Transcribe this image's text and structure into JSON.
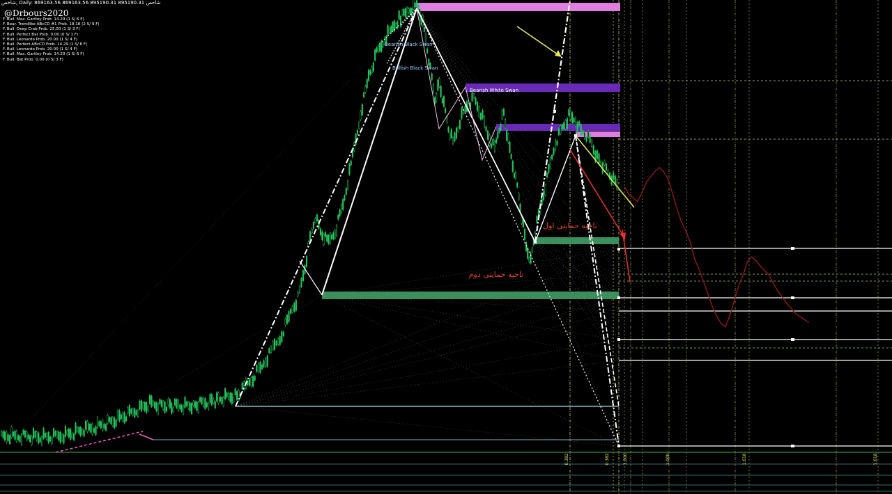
{
  "header": {
    "instrument": "شاخص",
    "timeframe": "Daily",
    "ohlc": "869163.56 869163.56 895190.31 895190.31",
    "instrument_repeat": "شاخص"
  },
  "watermark": "@Drbours2020",
  "pattern_probabilities": [
    "F. Bull. Max. Gartley Prob. 14.29 (1 S/ 6 F)",
    "F. Bear. Trendlike ABcCD #1 Prob. 18.18 (2 S/ 9 F)",
    "F. Bull. Deep Crab Prob. 25.00 (1 S/ 3 F)",
    "F. Bull. Perfect Bat Prob. 0.00 (0 S/ 1 F)",
    "F. Bull. Leonardo Prob. 20.00 (1 S/ 4 F)",
    "F. Bull. Perfect ABcCD Prob. 14.29 (1 S/ 6 F)",
    "F. Bull. Leonardo Prob. 20.00 (1 S/ 4 F)",
    "F. Bull. Max. Gartley Prob. 14.29 (1 S/ 6 F)",
    "F. Bull. Bat Prob. 0.00 (0 S/ 3 F)"
  ],
  "pattern_labels": {
    "bearish_black_swan": "Bearish Black Swan",
    "bullish_black_swan": "Bullish Black Swan",
    "bearish_white_swan": "Bearish White Swan"
  },
  "support_zone_1": "ناحیه حمایتی اول",
  "support_zone_2": "ناحیه حمایتی دوم",
  "fib_bottom_labels": [
    "0.382",
    "0.382",
    "1.000",
    "1.000",
    "1.618",
    "1.618"
  ],
  "colors": {
    "background": "#000000",
    "candles": "#22c55e",
    "pattern_white": "#ffffff",
    "zone_green": "#3a8f5c",
    "zone_pink": "#e07ee0",
    "zone_purple": "#6a2ab8",
    "forecast": "#8b1a1a",
    "arrow_yellow": "#e6e65a",
    "arrow_red": "#e03030",
    "label_red": "#e0442c",
    "swan_label": "#9fd0ff"
  },
  "chart_data": {
    "type": "candlestick",
    "series": [
      {
        "name": "",
        "values": [
          20,
          22,
          21,
          23,
          22,
          21,
          20,
          20,
          21,
          23,
          25,
          27,
          30,
          32,
          35,
          38,
          41,
          44,
          48,
          52,
          57,
          62,
          66,
          62,
          64,
          70,
          78,
          90,
          105,
          120,
          140,
          160,
          190,
          215,
          250,
          290,
          320,
          300,
          285,
          305,
          345,
          400,
          460,
          510,
          540,
          560,
          575,
          590,
          600,
          605,
          590,
          560,
          520,
          480,
          500,
          470,
          440,
          420,
          450,
          470,
          480,
          460,
          430,
          410,
          440,
          460,
          420,
          390,
          360,
          320,
          280,
          260,
          300,
          340,
          380,
          420,
          440,
          455,
          450,
          435,
          430,
          420,
          400,
          390,
          380,
          370,
          360
        ]
      }
    ],
    "forecast": [
      360,
      350,
      345,
      340,
      352,
      366,
      374,
      381,
      386,
      380,
      370,
      350,
      330,
      312,
      300,
      285,
      262,
      248,
      232,
      215,
      198,
      185,
      175,
      170,
      185,
      205,
      225,
      240,
      258,
      265,
      260,
      252,
      246,
      240,
      228,
      218,
      210,
      202,
      195,
      188,
      184,
      180,
      176
    ]
  }
}
